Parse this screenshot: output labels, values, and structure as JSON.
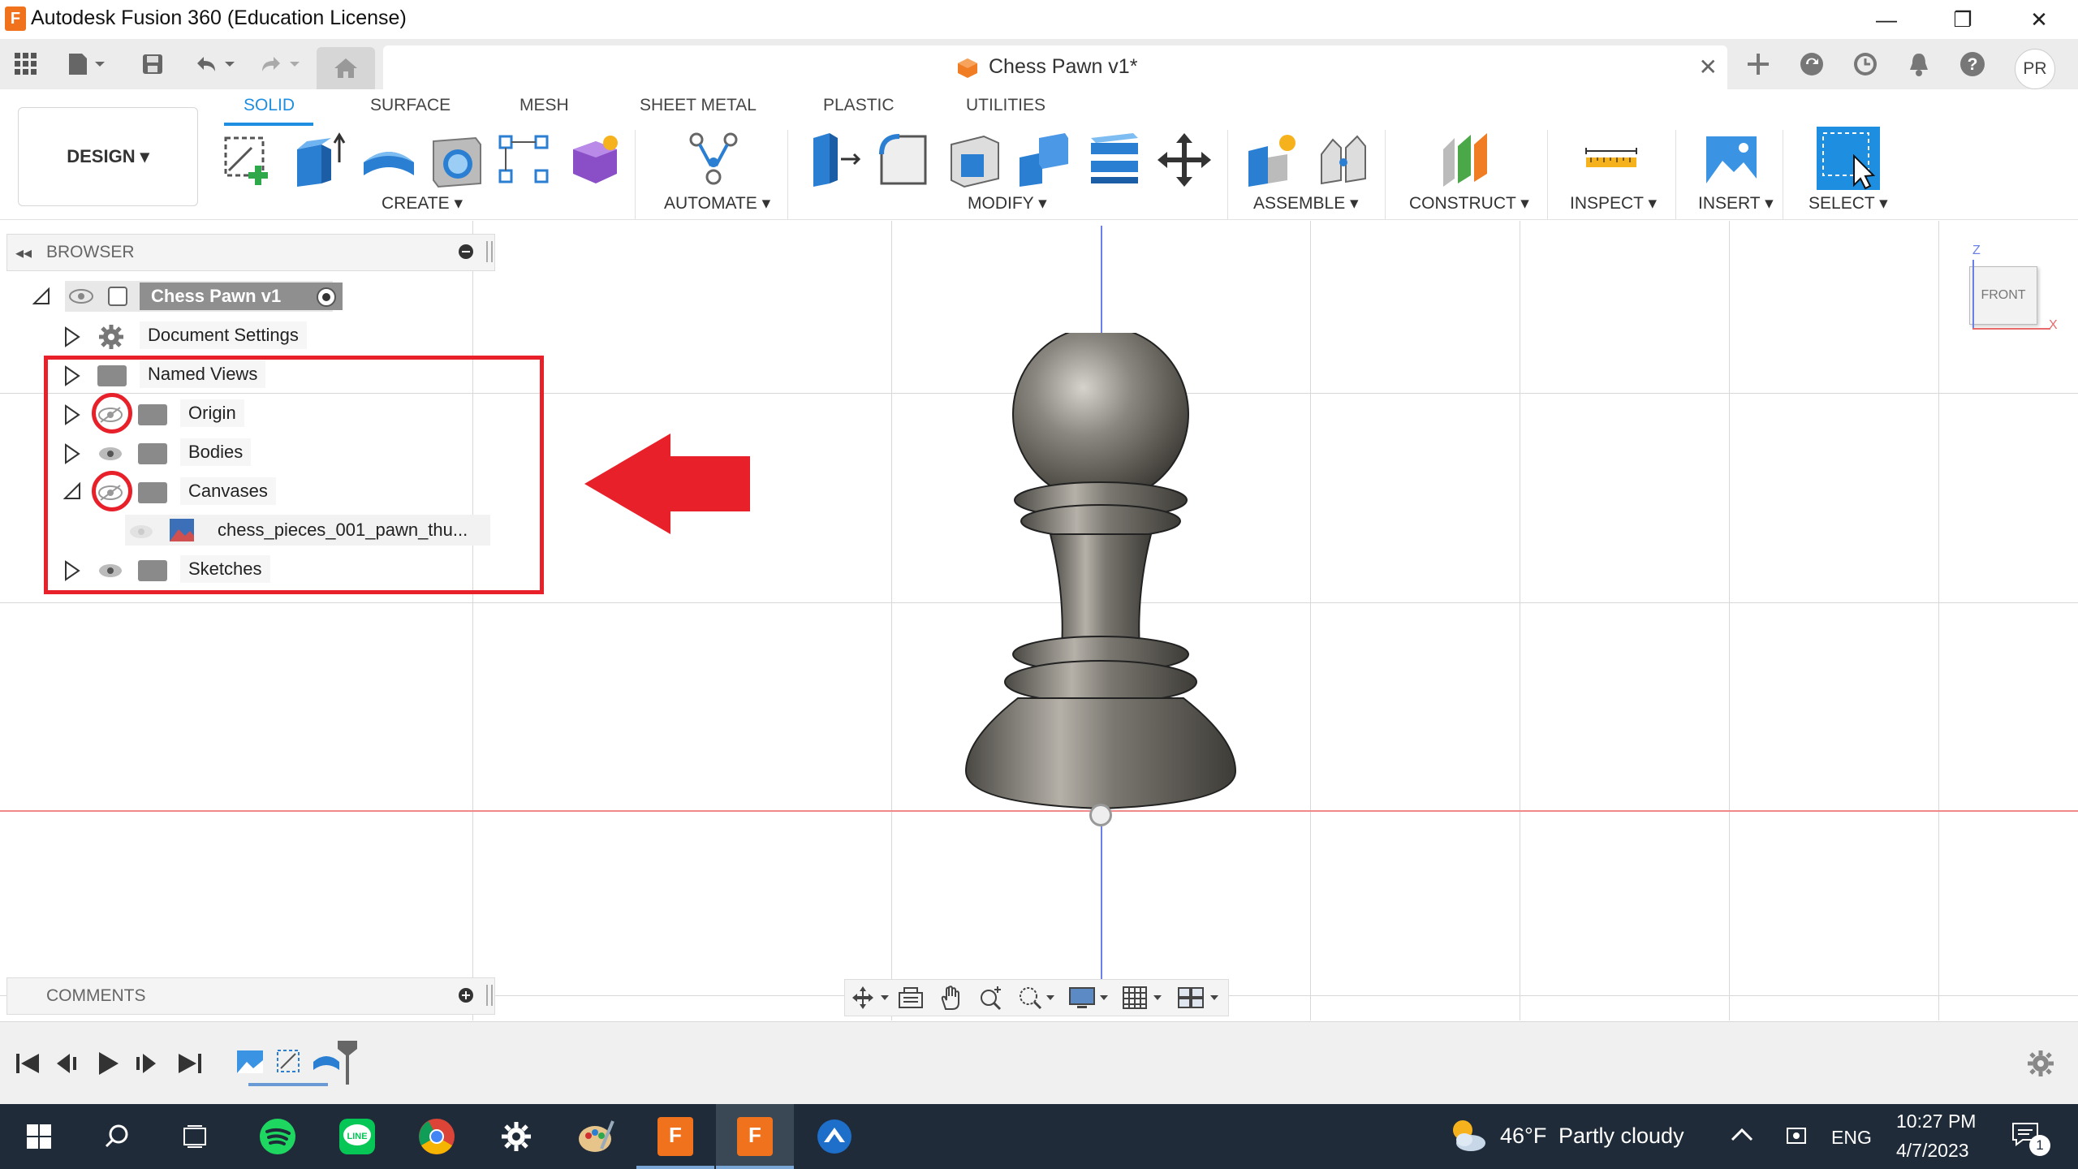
{
  "window": {
    "title": "Autodesk Fusion 360 (Education License)",
    "minimize": "—",
    "maximize": "❐",
    "close": "✕"
  },
  "document_tab": {
    "label": "Chess Pawn v1*",
    "close": "✕"
  },
  "user": {
    "initials": "PR"
  },
  "ribbon": {
    "workspace": "DESIGN ▾",
    "tabs": [
      "SOLID",
      "SURFACE",
      "MESH",
      "SHEET METAL",
      "PLASTIC",
      "UTILITIES"
    ],
    "active_tab": "SOLID",
    "groups": {
      "create": "CREATE ▾",
      "automate": "AUTOMATE ▾",
      "modify": "MODIFY ▾",
      "assemble": "ASSEMBLE ▾",
      "construct": "CONSTRUCT ▾",
      "inspect": "INSPECT ▾",
      "insert": "INSERT ▾",
      "select": "SELECT ▾"
    }
  },
  "browser": {
    "header": "BROWSER",
    "root": "Chess Pawn v1",
    "items": [
      {
        "label": "Document Settings"
      },
      {
        "label": "Named Views"
      },
      {
        "label": "Origin"
      },
      {
        "label": "Bodies"
      },
      {
        "label": "Canvases"
      },
      {
        "label": "chess_pieces_001_pawn_thu..."
      },
      {
        "label": "Sketches"
      }
    ]
  },
  "viewcube": {
    "face": "FRONT",
    "z_axis": "Z",
    "x_axis": "X"
  },
  "comments": {
    "header": "COMMENTS"
  },
  "taskbar": {
    "weather_temp": "46°F",
    "weather_desc": "Partly cloudy",
    "language": "ENG",
    "time": "10:27 PM",
    "date": "4/7/2023",
    "notification_count": "1"
  },
  "colors": {
    "accent": "#1e8fe0",
    "annotation_red": "#e8202a",
    "taskbar": "#1f2b38"
  }
}
